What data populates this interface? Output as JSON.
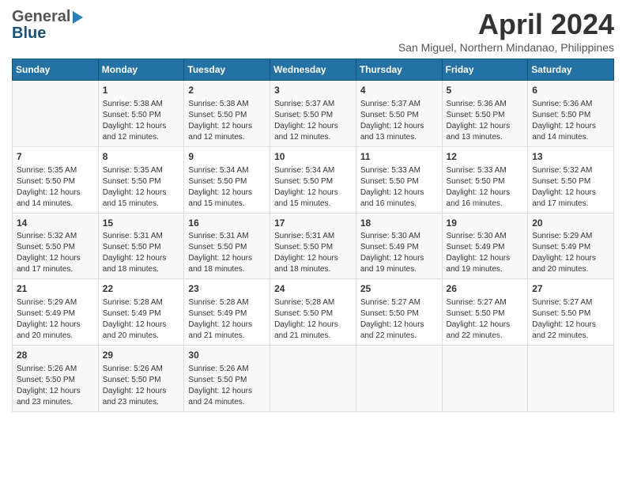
{
  "header": {
    "logo_general": "General",
    "logo_blue": "Blue",
    "title": "April 2024",
    "location": "San Miguel, Northern Mindanao, Philippines"
  },
  "days_of_week": [
    "Sunday",
    "Monday",
    "Tuesday",
    "Wednesday",
    "Thursday",
    "Friday",
    "Saturday"
  ],
  "weeks": [
    [
      {
        "day": "",
        "info": ""
      },
      {
        "day": "1",
        "info": "Sunrise: 5:38 AM\nSunset: 5:50 PM\nDaylight: 12 hours\nand 12 minutes."
      },
      {
        "day": "2",
        "info": "Sunrise: 5:38 AM\nSunset: 5:50 PM\nDaylight: 12 hours\nand 12 minutes."
      },
      {
        "day": "3",
        "info": "Sunrise: 5:37 AM\nSunset: 5:50 PM\nDaylight: 12 hours\nand 12 minutes."
      },
      {
        "day": "4",
        "info": "Sunrise: 5:37 AM\nSunset: 5:50 PM\nDaylight: 12 hours\nand 13 minutes."
      },
      {
        "day": "5",
        "info": "Sunrise: 5:36 AM\nSunset: 5:50 PM\nDaylight: 12 hours\nand 13 minutes."
      },
      {
        "day": "6",
        "info": "Sunrise: 5:36 AM\nSunset: 5:50 PM\nDaylight: 12 hours\nand 14 minutes."
      }
    ],
    [
      {
        "day": "7",
        "info": "Sunrise: 5:35 AM\nSunset: 5:50 PM\nDaylight: 12 hours\nand 14 minutes."
      },
      {
        "day": "8",
        "info": "Sunrise: 5:35 AM\nSunset: 5:50 PM\nDaylight: 12 hours\nand 15 minutes."
      },
      {
        "day": "9",
        "info": "Sunrise: 5:34 AM\nSunset: 5:50 PM\nDaylight: 12 hours\nand 15 minutes."
      },
      {
        "day": "10",
        "info": "Sunrise: 5:34 AM\nSunset: 5:50 PM\nDaylight: 12 hours\nand 15 minutes."
      },
      {
        "day": "11",
        "info": "Sunrise: 5:33 AM\nSunset: 5:50 PM\nDaylight: 12 hours\nand 16 minutes."
      },
      {
        "day": "12",
        "info": "Sunrise: 5:33 AM\nSunset: 5:50 PM\nDaylight: 12 hours\nand 16 minutes."
      },
      {
        "day": "13",
        "info": "Sunrise: 5:32 AM\nSunset: 5:50 PM\nDaylight: 12 hours\nand 17 minutes."
      }
    ],
    [
      {
        "day": "14",
        "info": "Sunrise: 5:32 AM\nSunset: 5:50 PM\nDaylight: 12 hours\nand 17 minutes."
      },
      {
        "day": "15",
        "info": "Sunrise: 5:31 AM\nSunset: 5:50 PM\nDaylight: 12 hours\nand 18 minutes."
      },
      {
        "day": "16",
        "info": "Sunrise: 5:31 AM\nSunset: 5:50 PM\nDaylight: 12 hours\nand 18 minutes."
      },
      {
        "day": "17",
        "info": "Sunrise: 5:31 AM\nSunset: 5:50 PM\nDaylight: 12 hours\nand 18 minutes."
      },
      {
        "day": "18",
        "info": "Sunrise: 5:30 AM\nSunset: 5:49 PM\nDaylight: 12 hours\nand 19 minutes."
      },
      {
        "day": "19",
        "info": "Sunrise: 5:30 AM\nSunset: 5:49 PM\nDaylight: 12 hours\nand 19 minutes."
      },
      {
        "day": "20",
        "info": "Sunrise: 5:29 AM\nSunset: 5:49 PM\nDaylight: 12 hours\nand 20 minutes."
      }
    ],
    [
      {
        "day": "21",
        "info": "Sunrise: 5:29 AM\nSunset: 5:49 PM\nDaylight: 12 hours\nand 20 minutes."
      },
      {
        "day": "22",
        "info": "Sunrise: 5:28 AM\nSunset: 5:49 PM\nDaylight: 12 hours\nand 20 minutes."
      },
      {
        "day": "23",
        "info": "Sunrise: 5:28 AM\nSunset: 5:49 PM\nDaylight: 12 hours\nand 21 minutes."
      },
      {
        "day": "24",
        "info": "Sunrise: 5:28 AM\nSunset: 5:50 PM\nDaylight: 12 hours\nand 21 minutes."
      },
      {
        "day": "25",
        "info": "Sunrise: 5:27 AM\nSunset: 5:50 PM\nDaylight: 12 hours\nand 22 minutes."
      },
      {
        "day": "26",
        "info": "Sunrise: 5:27 AM\nSunset: 5:50 PM\nDaylight: 12 hours\nand 22 minutes."
      },
      {
        "day": "27",
        "info": "Sunrise: 5:27 AM\nSunset: 5:50 PM\nDaylight: 12 hours\nand 22 minutes."
      }
    ],
    [
      {
        "day": "28",
        "info": "Sunrise: 5:26 AM\nSunset: 5:50 PM\nDaylight: 12 hours\nand 23 minutes."
      },
      {
        "day": "29",
        "info": "Sunrise: 5:26 AM\nSunset: 5:50 PM\nDaylight: 12 hours\nand 23 minutes."
      },
      {
        "day": "30",
        "info": "Sunrise: 5:26 AM\nSunset: 5:50 PM\nDaylight: 12 hours\nand 24 minutes."
      },
      {
        "day": "",
        "info": ""
      },
      {
        "day": "",
        "info": ""
      },
      {
        "day": "",
        "info": ""
      },
      {
        "day": "",
        "info": ""
      }
    ]
  ]
}
